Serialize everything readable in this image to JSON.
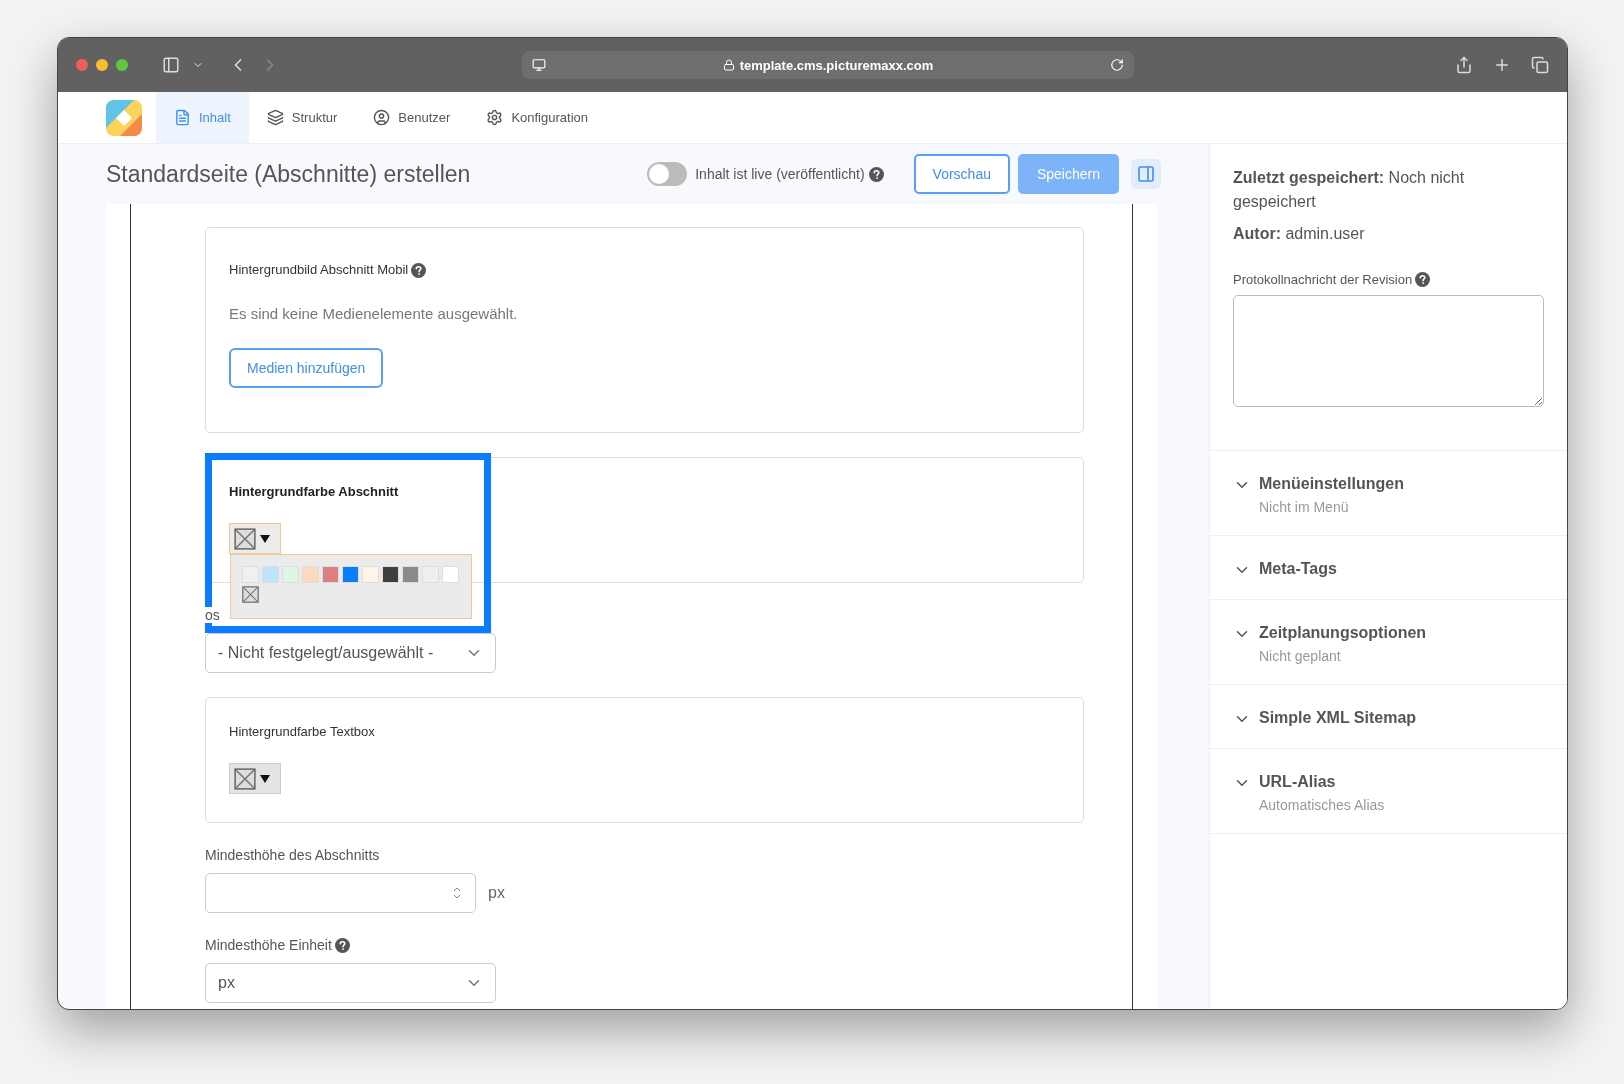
{
  "browser": {
    "url": "template.cms.picturemaxx.com"
  },
  "nav": {
    "tabs": [
      {
        "label": "Inhalt",
        "selected": true
      },
      {
        "label": "Struktur",
        "selected": false
      },
      {
        "label": "Benutzer",
        "selected": false
      },
      {
        "label": "Konfiguration",
        "selected": false
      }
    ]
  },
  "header": {
    "title": "Standardseite (Abschnitte) erstellen",
    "live_toggle": {
      "label": "Inhalt ist live (veröffentlicht)",
      "on": false
    },
    "buttons": [
      {
        "label": "Vorschau",
        "kind": "outline"
      },
      {
        "label": "Speichern",
        "kind": "primary"
      }
    ]
  },
  "form": {
    "fields": [
      {
        "kind": "media",
        "label": "Hintergrundbild Abschnitt Mobil",
        "help": true,
        "empty_text": "Es sind keine Medienelemente ausgewählt.",
        "button": "Medien hinzufügen"
      },
      {
        "kind": "color",
        "label": "Hintergrundfarbe Abschnitt",
        "help": false,
        "expanded": true,
        "highlighted": true,
        "swatches": [
          {
            "kind": "color",
            "color": "#f0f0f0"
          },
          {
            "kind": "color",
            "color": "#bde4fb"
          },
          {
            "kind": "color",
            "color": "#dcf7e8"
          },
          {
            "kind": "color",
            "color": "#fcd9bf"
          },
          {
            "kind": "color",
            "color": "#dc7f7f"
          },
          {
            "kind": "color",
            "color": "#0a7cff"
          },
          {
            "kind": "color",
            "color": "#fdf4ec"
          },
          {
            "kind": "color",
            "color": "#3f3f3f"
          },
          {
            "kind": "color",
            "color": "#8a8a8a"
          },
          {
            "kind": "color",
            "color": "#efefef"
          },
          {
            "kind": "color",
            "color": "#ffffff"
          },
          {
            "kind": "none"
          }
        ]
      },
      {
        "kind": "select",
        "label": "os",
        "help": false,
        "value": "- Nicht festgelegt/ausgewählt -"
      },
      {
        "kind": "color",
        "label": "Hintergrundfarbe Textbox",
        "help": false,
        "expanded": false,
        "highlighted": false
      },
      {
        "kind": "number",
        "label": "Mindesthöhe des Abschnitts",
        "help": false,
        "unit": "px"
      },
      {
        "kind": "select",
        "label": "Mindesthöhe Einheit",
        "help": true,
        "value": "px"
      }
    ]
  },
  "sidebar": {
    "meta": [
      "**Zuletzt gespeichert:** Noch nicht gespeichert",
      "**Autor:** admin.user"
    ],
    "revision": {
      "label": "Protokollnachricht der Revision"
    },
    "sections": [
      {
        "title": "Menüeinstellungen",
        "summary": "Nicht im Menü"
      },
      {
        "title": "Meta-Tags"
      },
      {
        "title": "Zeitplanungsoptionen",
        "summary": "Nicht geplant"
      },
      {
        "title": "Simple XML Sitemap"
      },
      {
        "title": "URL-Alias",
        "summary": "Automatisches Alias"
      }
    ]
  }
}
